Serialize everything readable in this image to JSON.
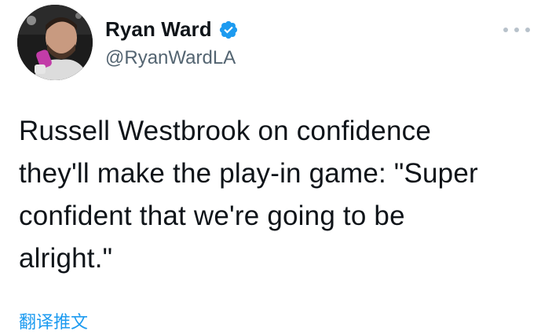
{
  "author": {
    "display_name": "Ryan Ward",
    "handle": "@RyanWardLA",
    "verified_icon": "verified-badge-icon",
    "verified_color": "#1d9bf0"
  },
  "menu": {
    "icon": "more-horizontal-icon"
  },
  "tweet": {
    "lines": [
      "Russell Westbrook on confidence",
      "they'll make the play-in game: \"Super",
      "confident that we're going to be",
      "alright.\""
    ]
  },
  "translate_label": "翻译推文",
  "colors": {
    "text": "#0f1419",
    "secondary": "#536471",
    "accent": "#1d9bf0"
  }
}
